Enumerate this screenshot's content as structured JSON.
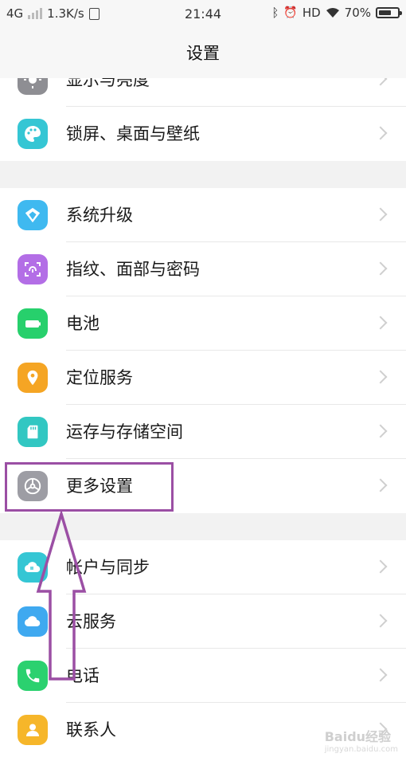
{
  "status_bar": {
    "network": "4G",
    "speed": "1.3K/s",
    "time": "21:44",
    "hd": "HD",
    "battery": "70%",
    "battery_level": 0.7
  },
  "header": {
    "title": "设置"
  },
  "groups": [
    {
      "items": [
        {
          "label": "显示与亮度",
          "icon": "sun-icon",
          "color": "#8e8e93"
        },
        {
          "label": "锁屏、桌面与壁纸",
          "icon": "palette-icon",
          "color": "#35c6d4"
        }
      ]
    },
    {
      "items": [
        {
          "label": "系统升级",
          "icon": "update-icon",
          "color": "#3fb9f0"
        },
        {
          "label": "指纹、面部与密码",
          "icon": "fingerprint-icon",
          "color": "#b36ee6"
        },
        {
          "label": "电池",
          "icon": "battery-icon",
          "color": "#27d06c"
        },
        {
          "label": "定位服务",
          "icon": "location-pin-icon",
          "color": "#f5a524"
        },
        {
          "label": "运存与存储空间",
          "icon": "sd-card-icon",
          "color": "#32c7c2"
        },
        {
          "label": "更多设置",
          "icon": "gear-icon",
          "color": "#9d9da4"
        }
      ]
    },
    {
      "items": [
        {
          "label": "帐户与同步",
          "icon": "cloud-sync-icon",
          "color": "#35c6d4"
        },
        {
          "label": "云服务",
          "icon": "cloud-icon",
          "color": "#3fa9f0"
        },
        {
          "label": "电话",
          "icon": "phone-icon",
          "color": "#2bd16f"
        },
        {
          "label": "联系人",
          "icon": "contact-icon",
          "color": "#f6b62a"
        }
      ]
    }
  ],
  "annotation": {
    "color": "#9b4fa4"
  },
  "watermark": {
    "text": "Baidu经验",
    "url": "jingyan.baidu.com"
  }
}
